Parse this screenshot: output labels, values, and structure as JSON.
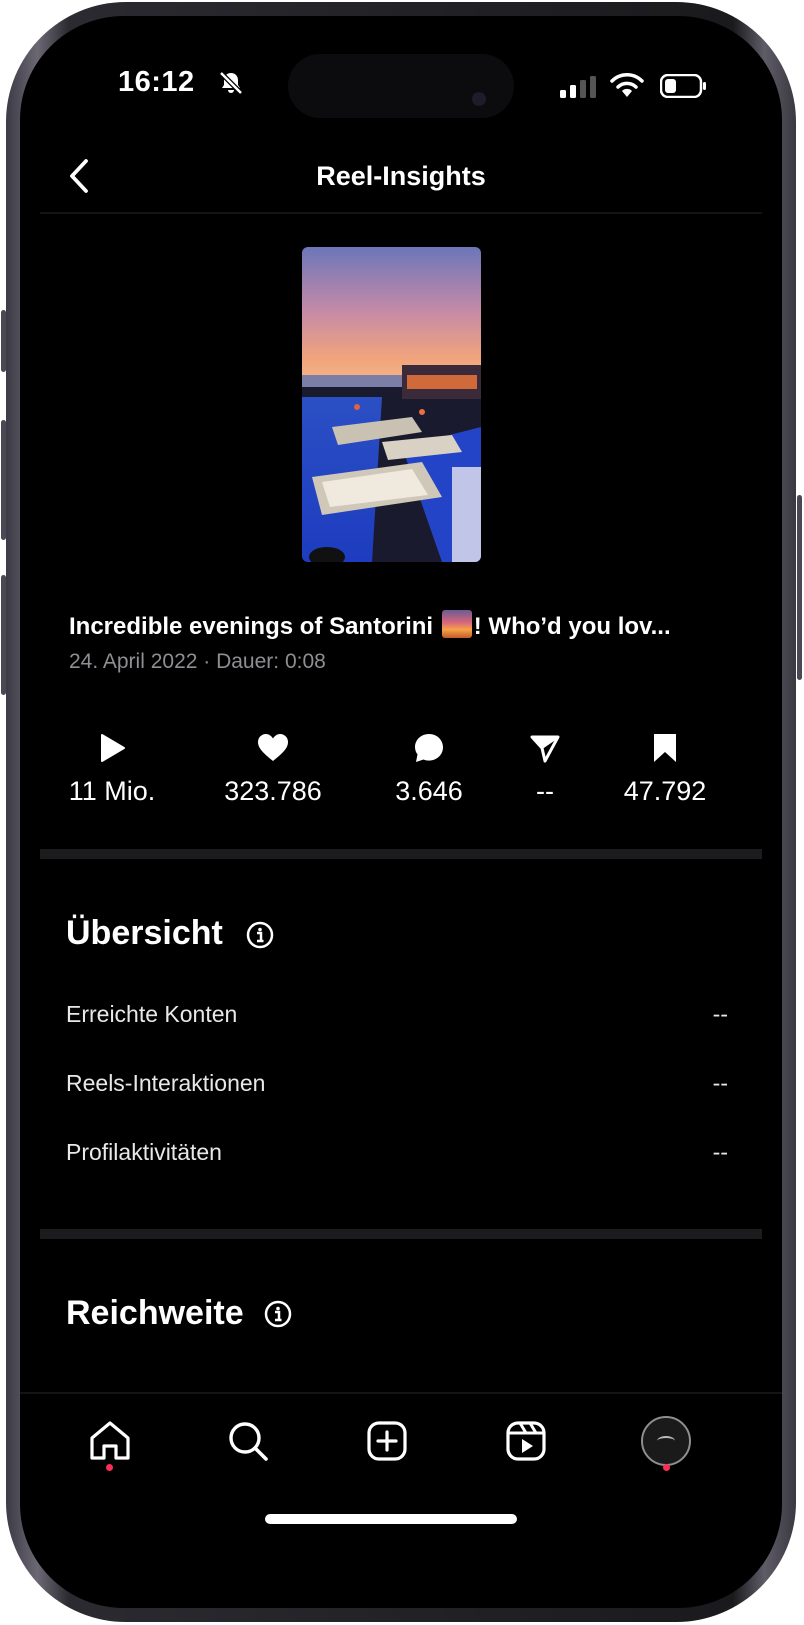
{
  "status_bar": {
    "time": "16:12"
  },
  "header": {
    "title": "Reel-Insights"
  },
  "reel": {
    "caption_before": "Incredible evenings of Santorini",
    "caption_after": "! Who’d you lov...",
    "meta": "24. April 2022 · Dauer: 0:08"
  },
  "stats": [
    {
      "icon": "play-icon",
      "value": "11 Mio."
    },
    {
      "icon": "heart-icon",
      "value": "323.786"
    },
    {
      "icon": "comment-icon",
      "value": "3.646"
    },
    {
      "icon": "share-icon",
      "value": "--"
    },
    {
      "icon": "bookmark-icon",
      "value": "47.792"
    }
  ],
  "overview": {
    "title": "Übersicht",
    "rows": [
      {
        "label": "Erreichte Konten",
        "value": "--"
      },
      {
        "label": "Reels-Interaktionen",
        "value": "--"
      },
      {
        "label": "Profilaktivitäten",
        "value": "--"
      }
    ]
  },
  "reach": {
    "title": "Reichweite"
  },
  "tab_bar": [
    "home-icon",
    "search-icon",
    "create-icon",
    "reels-icon",
    "profile-avatar"
  ],
  "colors": {
    "background": "#000000",
    "text": "#ffffff",
    "secondary_text": "#8e8e93",
    "notification_dot": "#ff2d55"
  }
}
